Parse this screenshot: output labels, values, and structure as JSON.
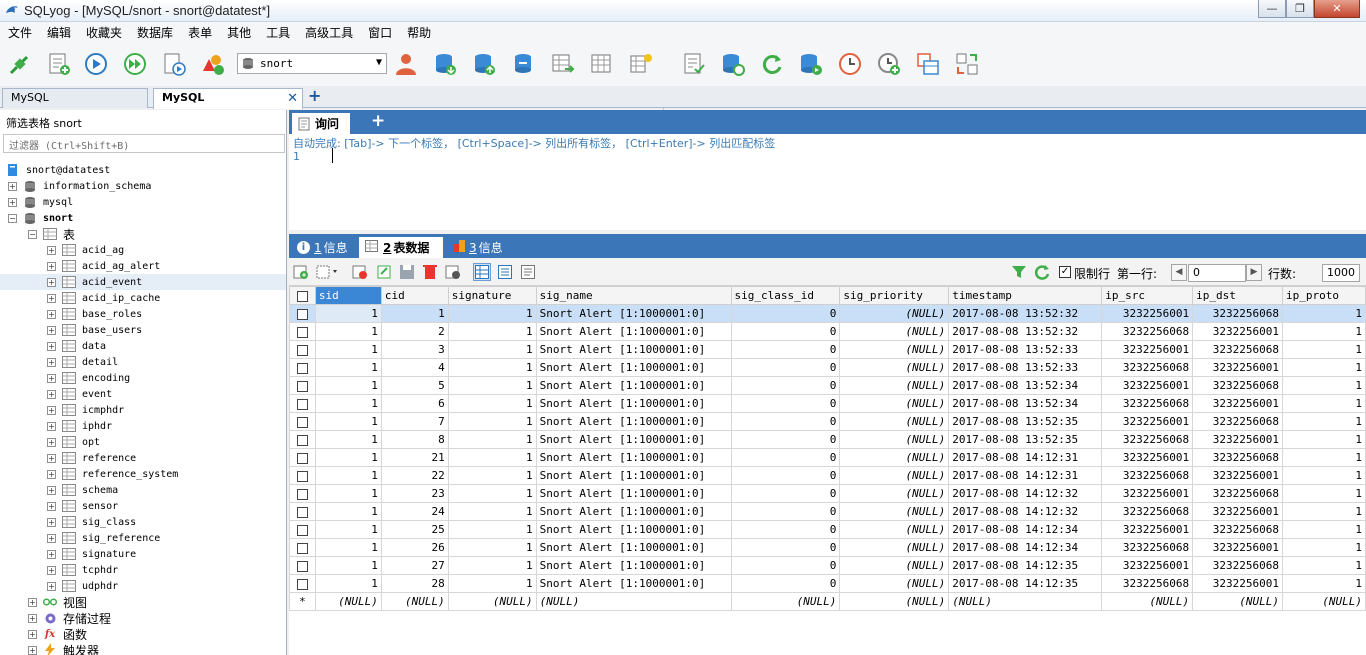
{
  "window": {
    "title": "SQLyog - [MySQL/snort - snort@datatest*]",
    "controls": [
      "—",
      "❐",
      "✕"
    ]
  },
  "menu": [
    "文件",
    "编辑",
    "收藏夹",
    "数据库",
    "表单",
    "其他",
    "工具",
    "高级工具",
    "窗口",
    "帮助"
  ],
  "toolbar": {
    "database": "snort"
  },
  "connection_tabs": [
    {
      "label": "MySQL",
      "active": false
    },
    {
      "label": "MySQL",
      "active": true
    }
  ],
  "left": {
    "filter_label": "筛选表格 snort",
    "filter_placeholder": "过滤器 (Ctrl+Shift+B)",
    "connection": "snort@datatest",
    "databases": [
      "information_schema",
      "mysql",
      "snort"
    ],
    "tables_folder": "表",
    "tables": [
      "acid_ag",
      "acid_ag_alert",
      "acid_event",
      "acid_ip_cache",
      "base_roles",
      "base_users",
      "data",
      "detail",
      "encoding",
      "event",
      "icmphdr",
      "iphdr",
      "opt",
      "reference",
      "reference_system",
      "schema",
      "sensor",
      "sig_class",
      "sig_reference",
      "signature",
      "tcphdr",
      "udphdr"
    ],
    "folders": [
      "视图",
      "存储过程",
      "函数",
      "触发器"
    ]
  },
  "editor": {
    "tab": "询问",
    "hint": "自动完成: [Tab]-> 下一个标签， [Ctrl+Space]-> 列出所有标签， [Ctrl+Enter]-> 列出匹配标签",
    "line": "1"
  },
  "result_tabs": [
    {
      "num": "1",
      "label": "信息"
    },
    {
      "num": "2",
      "label": "表数据"
    },
    {
      "num": "3",
      "label": "信息"
    }
  ],
  "result_toolbar": {
    "limit_label": "限制行",
    "first_row_label": "第一行:",
    "first_row_value": "0",
    "rows_label": "行数:",
    "rows_value": "1000"
  },
  "grid": {
    "columns": [
      "sid",
      "cid",
      "signature",
      "sig_name",
      "sig_class_id",
      "sig_priority",
      "timestamp",
      "ip_src",
      "ip_dst",
      "ip_proto"
    ],
    "rows": [
      [
        "1",
        "1",
        "1",
        "Snort Alert [1:1000001:0]",
        "0",
        "(NULL)",
        "2017-08-08 13:52:32",
        "3232256001",
        "3232256068",
        "1"
      ],
      [
        "1",
        "2",
        "1",
        "Snort Alert [1:1000001:0]",
        "0",
        "(NULL)",
        "2017-08-08 13:52:32",
        "3232256068",
        "3232256001",
        "1"
      ],
      [
        "1",
        "3",
        "1",
        "Snort Alert [1:1000001:0]",
        "0",
        "(NULL)",
        "2017-08-08 13:52:33",
        "3232256001",
        "3232256068",
        "1"
      ],
      [
        "1",
        "4",
        "1",
        "Snort Alert [1:1000001:0]",
        "0",
        "(NULL)",
        "2017-08-08 13:52:33",
        "3232256068",
        "3232256001",
        "1"
      ],
      [
        "1",
        "5",
        "1",
        "Snort Alert [1:1000001:0]",
        "0",
        "(NULL)",
        "2017-08-08 13:52:34",
        "3232256001",
        "3232256068",
        "1"
      ],
      [
        "1",
        "6",
        "1",
        "Snort Alert [1:1000001:0]",
        "0",
        "(NULL)",
        "2017-08-08 13:52:34",
        "3232256068",
        "3232256001",
        "1"
      ],
      [
        "1",
        "7",
        "1",
        "Snort Alert [1:1000001:0]",
        "0",
        "(NULL)",
        "2017-08-08 13:52:35",
        "3232256001",
        "3232256068",
        "1"
      ],
      [
        "1",
        "8",
        "1",
        "Snort Alert [1:1000001:0]",
        "0",
        "(NULL)",
        "2017-08-08 13:52:35",
        "3232256068",
        "3232256001",
        "1"
      ],
      [
        "1",
        "21",
        "1",
        "Snort Alert [1:1000001:0]",
        "0",
        "(NULL)",
        "2017-08-08 14:12:31",
        "3232256001",
        "3232256068",
        "1"
      ],
      [
        "1",
        "22",
        "1",
        "Snort Alert [1:1000001:0]",
        "0",
        "(NULL)",
        "2017-08-08 14:12:31",
        "3232256068",
        "3232256001",
        "1"
      ],
      [
        "1",
        "23",
        "1",
        "Snort Alert [1:1000001:0]",
        "0",
        "(NULL)",
        "2017-08-08 14:12:32",
        "3232256001",
        "3232256068",
        "1"
      ],
      [
        "1",
        "24",
        "1",
        "Snort Alert [1:1000001:0]",
        "0",
        "(NULL)",
        "2017-08-08 14:12:32",
        "3232256068",
        "3232256001",
        "1"
      ],
      [
        "1",
        "25",
        "1",
        "Snort Alert [1:1000001:0]",
        "0",
        "(NULL)",
        "2017-08-08 14:12:34",
        "3232256001",
        "3232256068",
        "1"
      ],
      [
        "1",
        "26",
        "1",
        "Snort Alert [1:1000001:0]",
        "0",
        "(NULL)",
        "2017-08-08 14:12:34",
        "3232256068",
        "3232256001",
        "1"
      ],
      [
        "1",
        "27",
        "1",
        "Snort Alert [1:1000001:0]",
        "0",
        "(NULL)",
        "2017-08-08 14:12:35",
        "3232256001",
        "3232256068",
        "1"
      ],
      [
        "1",
        "28",
        "1",
        "Snort Alert [1:1000001:0]",
        "0",
        "(NULL)",
        "2017-08-08 14:12:35",
        "3232256068",
        "3232256001",
        "1"
      ]
    ],
    "new_row_marker": "*",
    "null_text": "(NULL)"
  },
  "colors": {
    "accent": "#3a76b8",
    "selected_header": "#3b87d6",
    "selected_row": "#c9dff7",
    "hint_text": "#3a7ab5"
  }
}
